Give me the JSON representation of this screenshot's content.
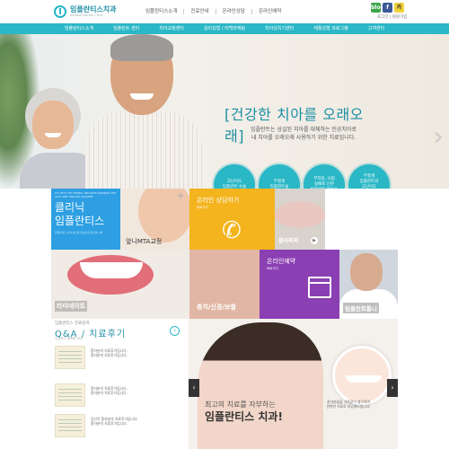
{
  "header": {
    "logo_name": "임플란티스치과",
    "logo_sub": "Implant Dental Clinic",
    "topnav": [
      "임플란티스소개",
      "진료안내",
      "온라인상담",
      "온라인예약"
    ],
    "sns": [
      "blog",
      "f",
      "카"
    ],
    "util": "로그인 | 회원가입"
  },
  "mainnav": [
    "임플란티스소개",
    "임플란트 센터",
    "치아교정센터",
    "심미성형 / 미백마케팅",
    "치아성치기센터",
    "재활성형 프로그램",
    "고객센터"
  ],
  "hero": {
    "title": "[건강한 치아를 오래오래]",
    "desc": "임플란트는 상실된 치아를 대체하는 인공치아로\n내 치아를 오래오래 사용하기 위한 치료입니다.",
    "circles": [
      "고난이도\n임플란트 수술",
      "무절개\n임플란트술",
      "부작용, 식립\n실패로 인한\n임플란트 재수술",
      "무절개\n임플란트와\n고난이도\n골이식 수술"
    ]
  },
  "tiles": {
    "clinic_en": "IT'S LET'S THE DENTAL IMPLANTS WORKING THE HIGH SPEC IMPLANT SHARPEN",
    "clinic_ko_1": "클리닉",
    "clinic_ko_2": "임플란티스",
    "clinic_small": "임플란티스 치과 최고의 의료진과 최고의 시설",
    "ortho": "앞니MTA교정",
    "online_consult": "온라인 상담하기",
    "online_more": "바로가기",
    "clinic_pix": "클리피써",
    "laminate": "라미네이트",
    "gum": "충치/신경/보철",
    "online_reserve": "온라인예약",
    "reserve_more": "바로가기",
    "implant_doc": "임플란트틀니"
  },
  "qa": {
    "crumb": "임플란티스 진료일지",
    "title": "Q&A / 치료후기",
    "sub": "건강하고 행복한 치아",
    "rows": [
      "환자분의 치료후기입니다.\n환자분의 치료후기입니다.",
      "환자분의 치료후기입니다.\n환자분의 치료후기입니다.",
      "당신이 환자분의 치료후기입니다.\n환자분의 치료후기입니다."
    ]
  },
  "banner": {
    "line1": "최고의 치료를 자부하는",
    "line2": "임플란티스 치과!",
    "desc": "환자분들을 가족같이 생각하며\n완벽한 치료로 보답해드립니다."
  },
  "colors": {
    "accent": "#2ab7c6",
    "blue_tile": "#2d9fe2",
    "yellow_tile": "#f3b41e",
    "purple_tile": "#8a3fb3"
  }
}
